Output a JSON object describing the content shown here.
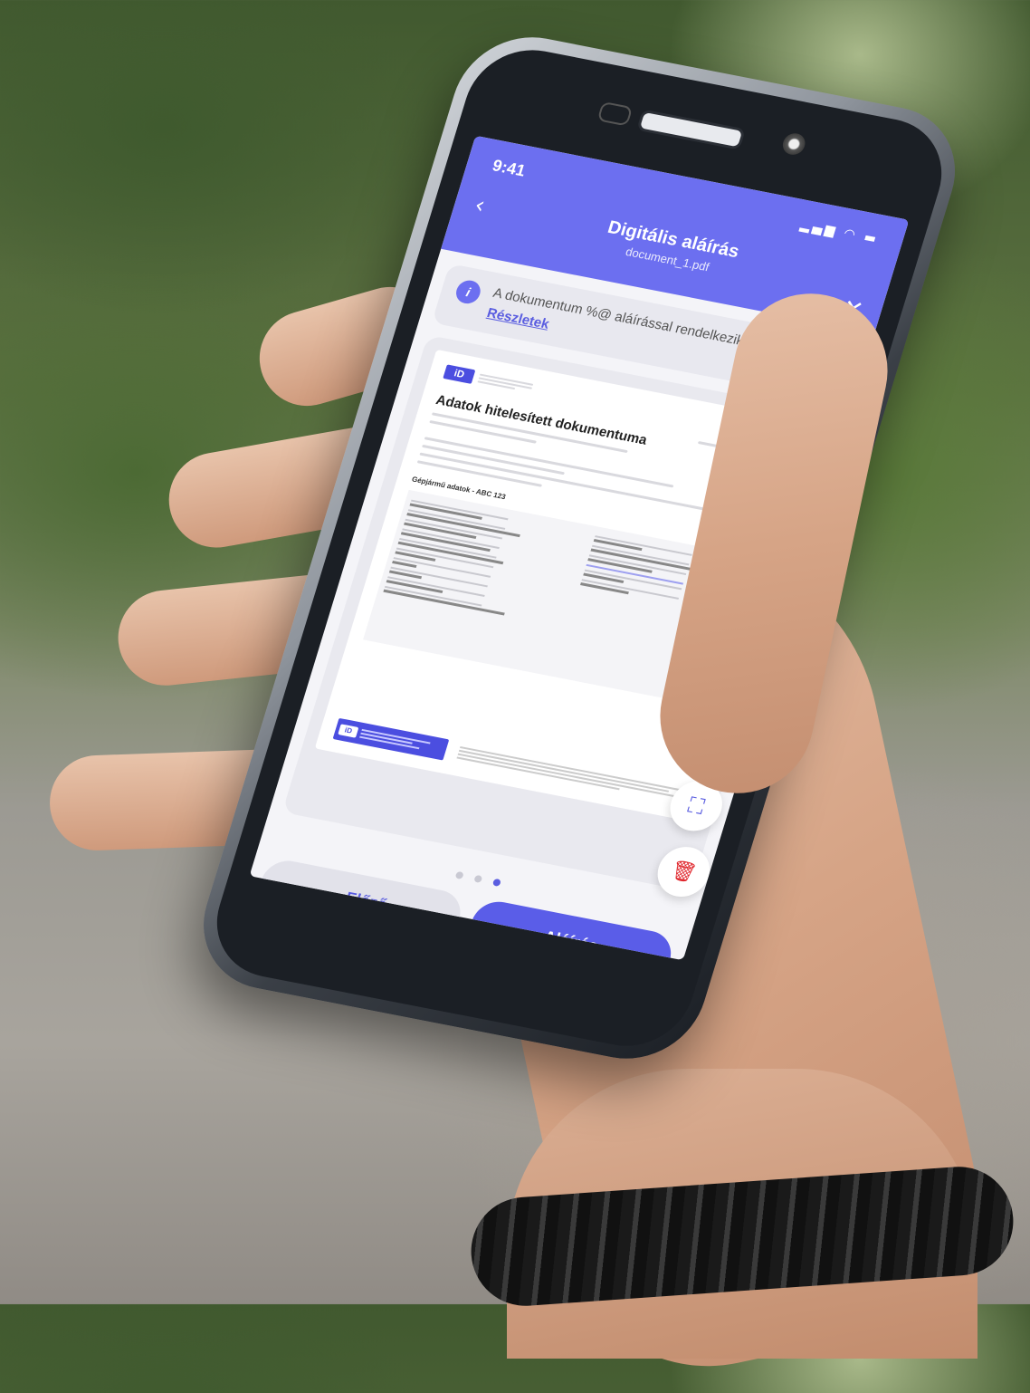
{
  "status_bar": {
    "time": "9:41",
    "icons": "▂▄▆ ◠ ▬"
  },
  "header": {
    "back_icon": "‹",
    "title": "Digitális aláírás",
    "subtitle": "document_1.pdf",
    "close_icon": "✕"
  },
  "info": {
    "icon": "i",
    "text": "A dokumentum %@ aláírással rendelkezik.",
    "link": "Részletek"
  },
  "document": {
    "logo": "iD",
    "title": "Adatok hitelesített dokumentuma",
    "section": "Gépjármű adatok - ABC 123"
  },
  "pagination": {
    "total": 3,
    "active": 3
  },
  "buttons": {
    "prev_icon": "‹",
    "prev_label": "Előző",
    "sign_label": "Aláírás",
    "expand_icon": "⛶",
    "delete_icon": "🗑"
  }
}
